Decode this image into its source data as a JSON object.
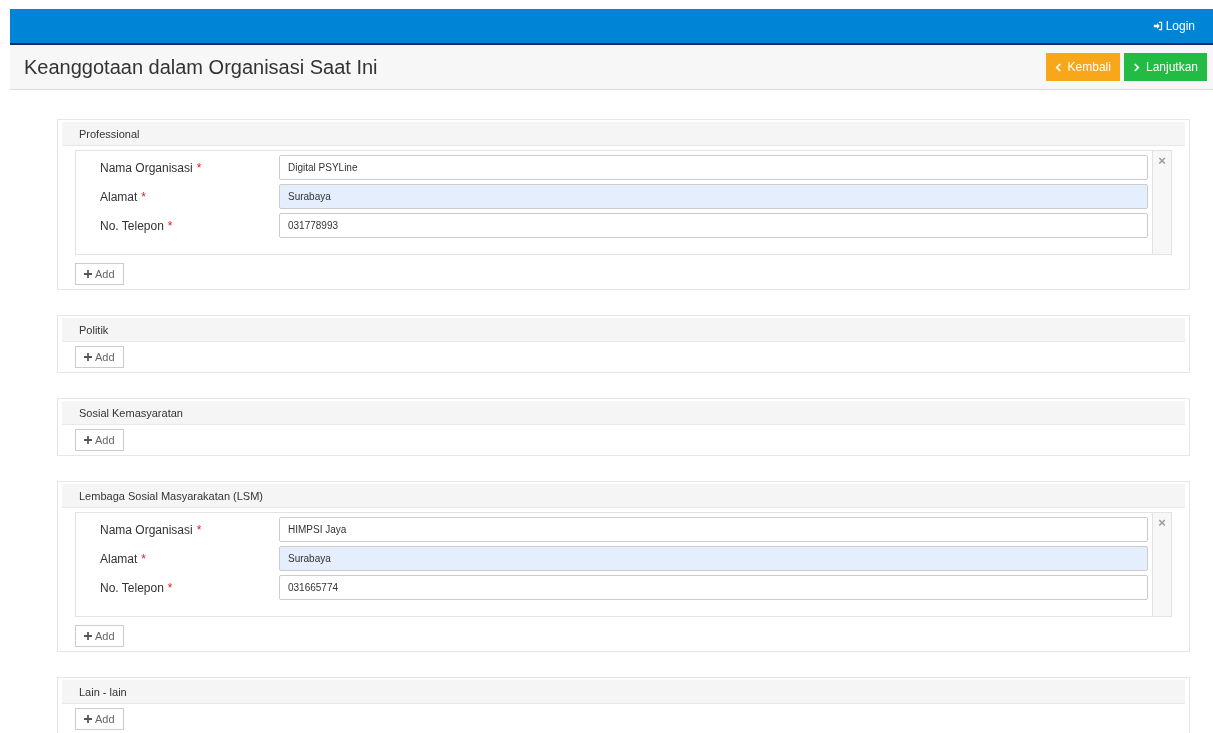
{
  "navbar": {
    "login": "Login"
  },
  "page": {
    "title": "Keanggotaan dalam Organisasi Saat Ini",
    "back_button": "Kembali",
    "next_button": "Lanjutkan"
  },
  "sections": [
    {
      "title": "Professional",
      "add_label": "Add",
      "entries": [
        {
          "remove": "×",
          "fields": [
            {
              "label": "Nama Organisasi",
              "required_mark": "*",
              "value": "Digital PSYLine",
              "autofilled": false
            },
            {
              "label": "Alamat",
              "required_mark": "*",
              "value": "Surabaya",
              "autofilled": true
            },
            {
              "label": "No. Telepon",
              "required_mark": "*",
              "value": "031778993",
              "autofilled": false
            }
          ]
        }
      ]
    },
    {
      "title": "Politik",
      "add_label": "Add"
    },
    {
      "title": "Sosial Kemasyaratan",
      "add_label": "Add"
    },
    {
      "title": "Lembaga Sosial Masyarakatan (LSM)",
      "add_label": "Add",
      "entries": [
        {
          "remove": "×",
          "fields": [
            {
              "label": "Nama Organisasi",
              "required_mark": "*",
              "value": "HIMPSI Jaya",
              "autofilled": false
            },
            {
              "label": "Alamat",
              "required_mark": "*",
              "value": "Surabaya",
              "autofilled": true
            },
            {
              "label": "No. Telepon",
              "required_mark": "*",
              "value": "031665774",
              "autofilled": false
            }
          ]
        }
      ]
    },
    {
      "title": "Lain - lain",
      "add_label": "Add"
    }
  ]
}
